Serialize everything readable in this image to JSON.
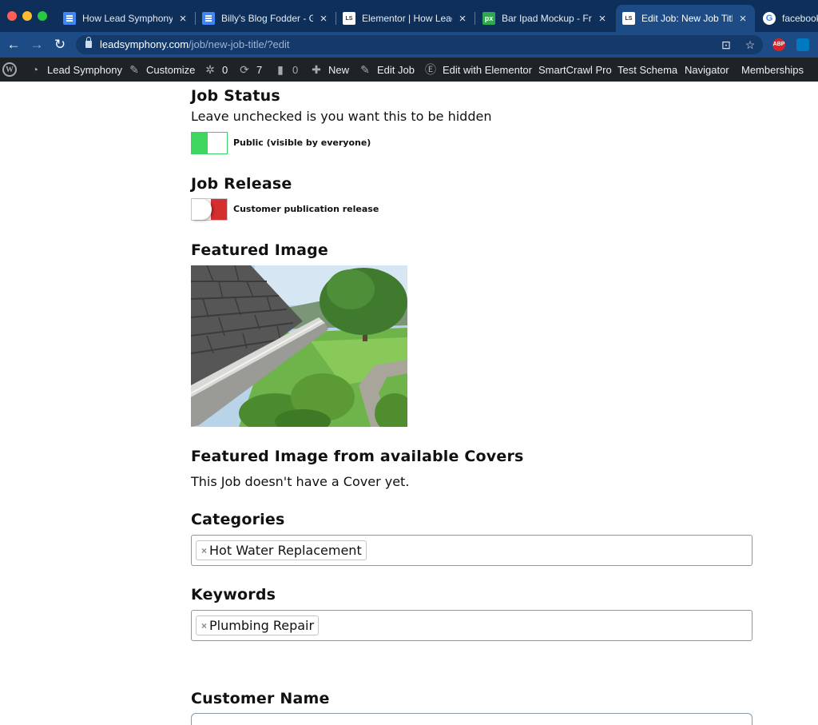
{
  "browser": {
    "tabs": [
      {
        "title": "How Lead Symphony H",
        "icon": "google-docs-icon",
        "active": false
      },
      {
        "title": "Billy's Blog Fodder - Go",
        "icon": "google-docs-icon",
        "active": false
      },
      {
        "title": "Elementor | How Lead S",
        "icon": "lead-symphony-icon",
        "active": false
      },
      {
        "title": "Bar Ipad Mockup - Free",
        "icon": "pixeden-icon",
        "active": false
      },
      {
        "title": "Edit Job: New Job Title",
        "icon": "lead-symphony-icon",
        "active": true
      },
      {
        "title": "facebook",
        "icon": "google-icon",
        "active": false
      }
    ],
    "url_domain": "leadsymphony.com",
    "url_path": "/job/new-job-title/?edit",
    "extensions": {
      "abp": "ABP"
    }
  },
  "adminbar": {
    "site_name": "Lead Symphony",
    "customize": "Customize",
    "updates_count": "0",
    "refresh_count": "7",
    "comments_count": "0",
    "new": "New",
    "edit_job": "Edit Job",
    "edit_elementor": "Edit with Elementor",
    "smartcrawl": "SmartCrawl Pro",
    "test_schema": "Test Schema",
    "navigator": "Navigator",
    "memberships": "Memberships"
  },
  "form": {
    "job_status": {
      "title": "Job Status",
      "help": "Leave unchecked is you want this to be hidden",
      "toggle_label": "Public (visible by everyone)",
      "checked": true
    },
    "job_release": {
      "title": "Job Release",
      "toggle_label": "Customer publication release",
      "checked": false
    },
    "featured_image": {
      "title": "Featured Image"
    },
    "featured_covers": {
      "title": "Featured Image from available Covers",
      "help": "This Job doesn't have a Cover yet."
    },
    "categories": {
      "title": "Categories",
      "selected": [
        "Hot Water Replacement"
      ]
    },
    "keywords": {
      "title": "Keywords",
      "selected": [
        "Plumbing Repair"
      ]
    },
    "customer_name": {
      "title": "Customer Name"
    }
  },
  "colors": {
    "toggle_on": "#3fd65f",
    "toggle_off": "#d42e2e",
    "browser_chrome": "#1c4b86",
    "adminbar": "#1d2327"
  }
}
